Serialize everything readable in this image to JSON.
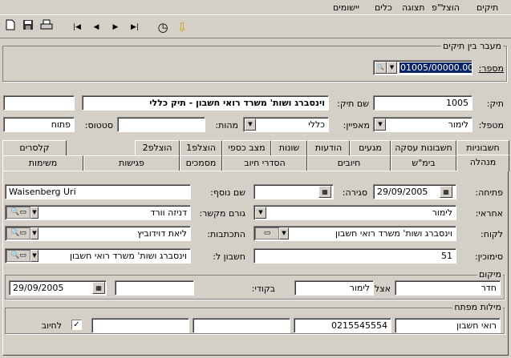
{
  "menu": [
    "תיקים",
    "הוצל\"פ",
    "תצוגה",
    "כלים",
    "יישומים"
  ],
  "toolbar": {
    "new": "▫",
    "save": "▪",
    "print": "⎙",
    "first": "|◀",
    "prev": "◀",
    "next": "▶",
    "last": "▶|",
    "timer": "◷",
    "down": "⇩"
  },
  "transfer": {
    "group": "מעבר בין תיקים",
    "number_label": "מספר:",
    "number_value": "01005/00000.0000"
  },
  "file": {
    "label": "תיק:",
    "value": "1005",
    "name_label": "שם תיק:",
    "name_value": "וינסברג ושות' משרד רואי חשבון - תיק כללי"
  },
  "handler": {
    "label": "מטפל:",
    "value": "לימור",
    "char_label": "מאפיין:",
    "char_value": "כללי",
    "essence_label": "מהות:",
    "essence_value": "",
    "status_label": "סטטוס:",
    "status_value": "פתוח"
  },
  "tabs_row1": [
    "חשבוניות",
    "חשבונות עסקה",
    "מגעים",
    "הודעות",
    "שונות",
    "מצב כספי",
    "הוצלפ1",
    "הוצלפ2",
    "קלסרים"
  ],
  "tabs_row2": [
    "מנהלה",
    "בימ\"ש",
    "חיובים",
    "הסדרי חיוב",
    "מסמכים",
    "פגישות",
    "משימות"
  ],
  "form": {
    "opening_label": "פתיחה:",
    "opening_value": "29/09/2005",
    "closing_label": "סגירה:",
    "closing_value": "",
    "other_name_label": "שם נוסף:",
    "other_name_value": "Waisenberg Uri",
    "responsible_label": "אחראי:",
    "responsible_value": "לימור",
    "contact_label": "גורם מקשר:",
    "contact_value": "דניזה וורד",
    "client_label": "לקוח:",
    "client_value": "וינסברג ושות' משרד רואי חשבון",
    "corr_label": "התכתבות:",
    "corr_value": "ליאת דוידוביץ",
    "ref_label": "סימוכין:",
    "ref_value": "51",
    "acc_label": "חשבון ל:",
    "acc_value": "וינסברג ושות' משרד רואי חשבון"
  },
  "location": {
    "group": "מיקום",
    "room": "חדר",
    "at_label": "אצל:",
    "at_value": "לימור",
    "check_label": "בקודי:",
    "check_value": "",
    "date_value": "29/09/2005"
  },
  "keywords": {
    "group": "מילות מפתח",
    "k1": "רואי חשבון",
    "k2": "0215545554",
    "k3": "",
    "k4": "",
    "k5": "",
    "charge_label": "לחיוב",
    "charge_checked": "✓"
  }
}
